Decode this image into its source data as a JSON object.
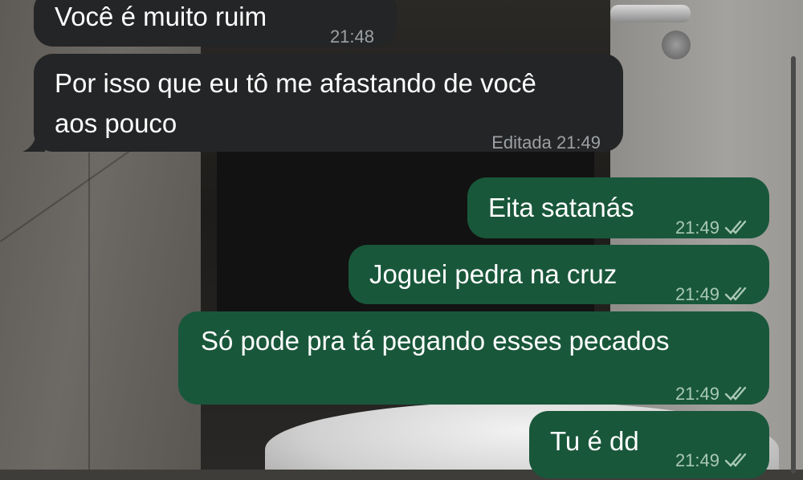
{
  "messages": [
    {
      "direction": "incoming",
      "text": "Você é muito ruim",
      "time": "21:48",
      "edited_label": ""
    },
    {
      "direction": "incoming",
      "text_line1": "Por isso que eu tô me afastando de você",
      "text_line2": "aos pouco",
      "time": "21:49",
      "edited_label": "Editada"
    },
    {
      "direction": "outgoing",
      "text": "Eita satanás",
      "time": "21:49",
      "status": "read"
    },
    {
      "direction": "outgoing",
      "text": "Joguei pedra na cruz",
      "time": "21:49",
      "status": "read"
    },
    {
      "direction": "outgoing",
      "text": "Só pode pra tá pegando esses pecados",
      "time": "21:49",
      "status": "read"
    },
    {
      "direction": "outgoing",
      "text": "Tu é dd",
      "time": "21:49",
      "status": "read"
    }
  ],
  "colors": {
    "incoming_bubble": "#242526",
    "outgoing_bubble": "#19573a",
    "text": "#ffffff",
    "meta_incoming": "#9da1a4",
    "meta_outgoing": "#a9c9b4"
  },
  "icons": {
    "read_receipt": "double-check-icon"
  }
}
